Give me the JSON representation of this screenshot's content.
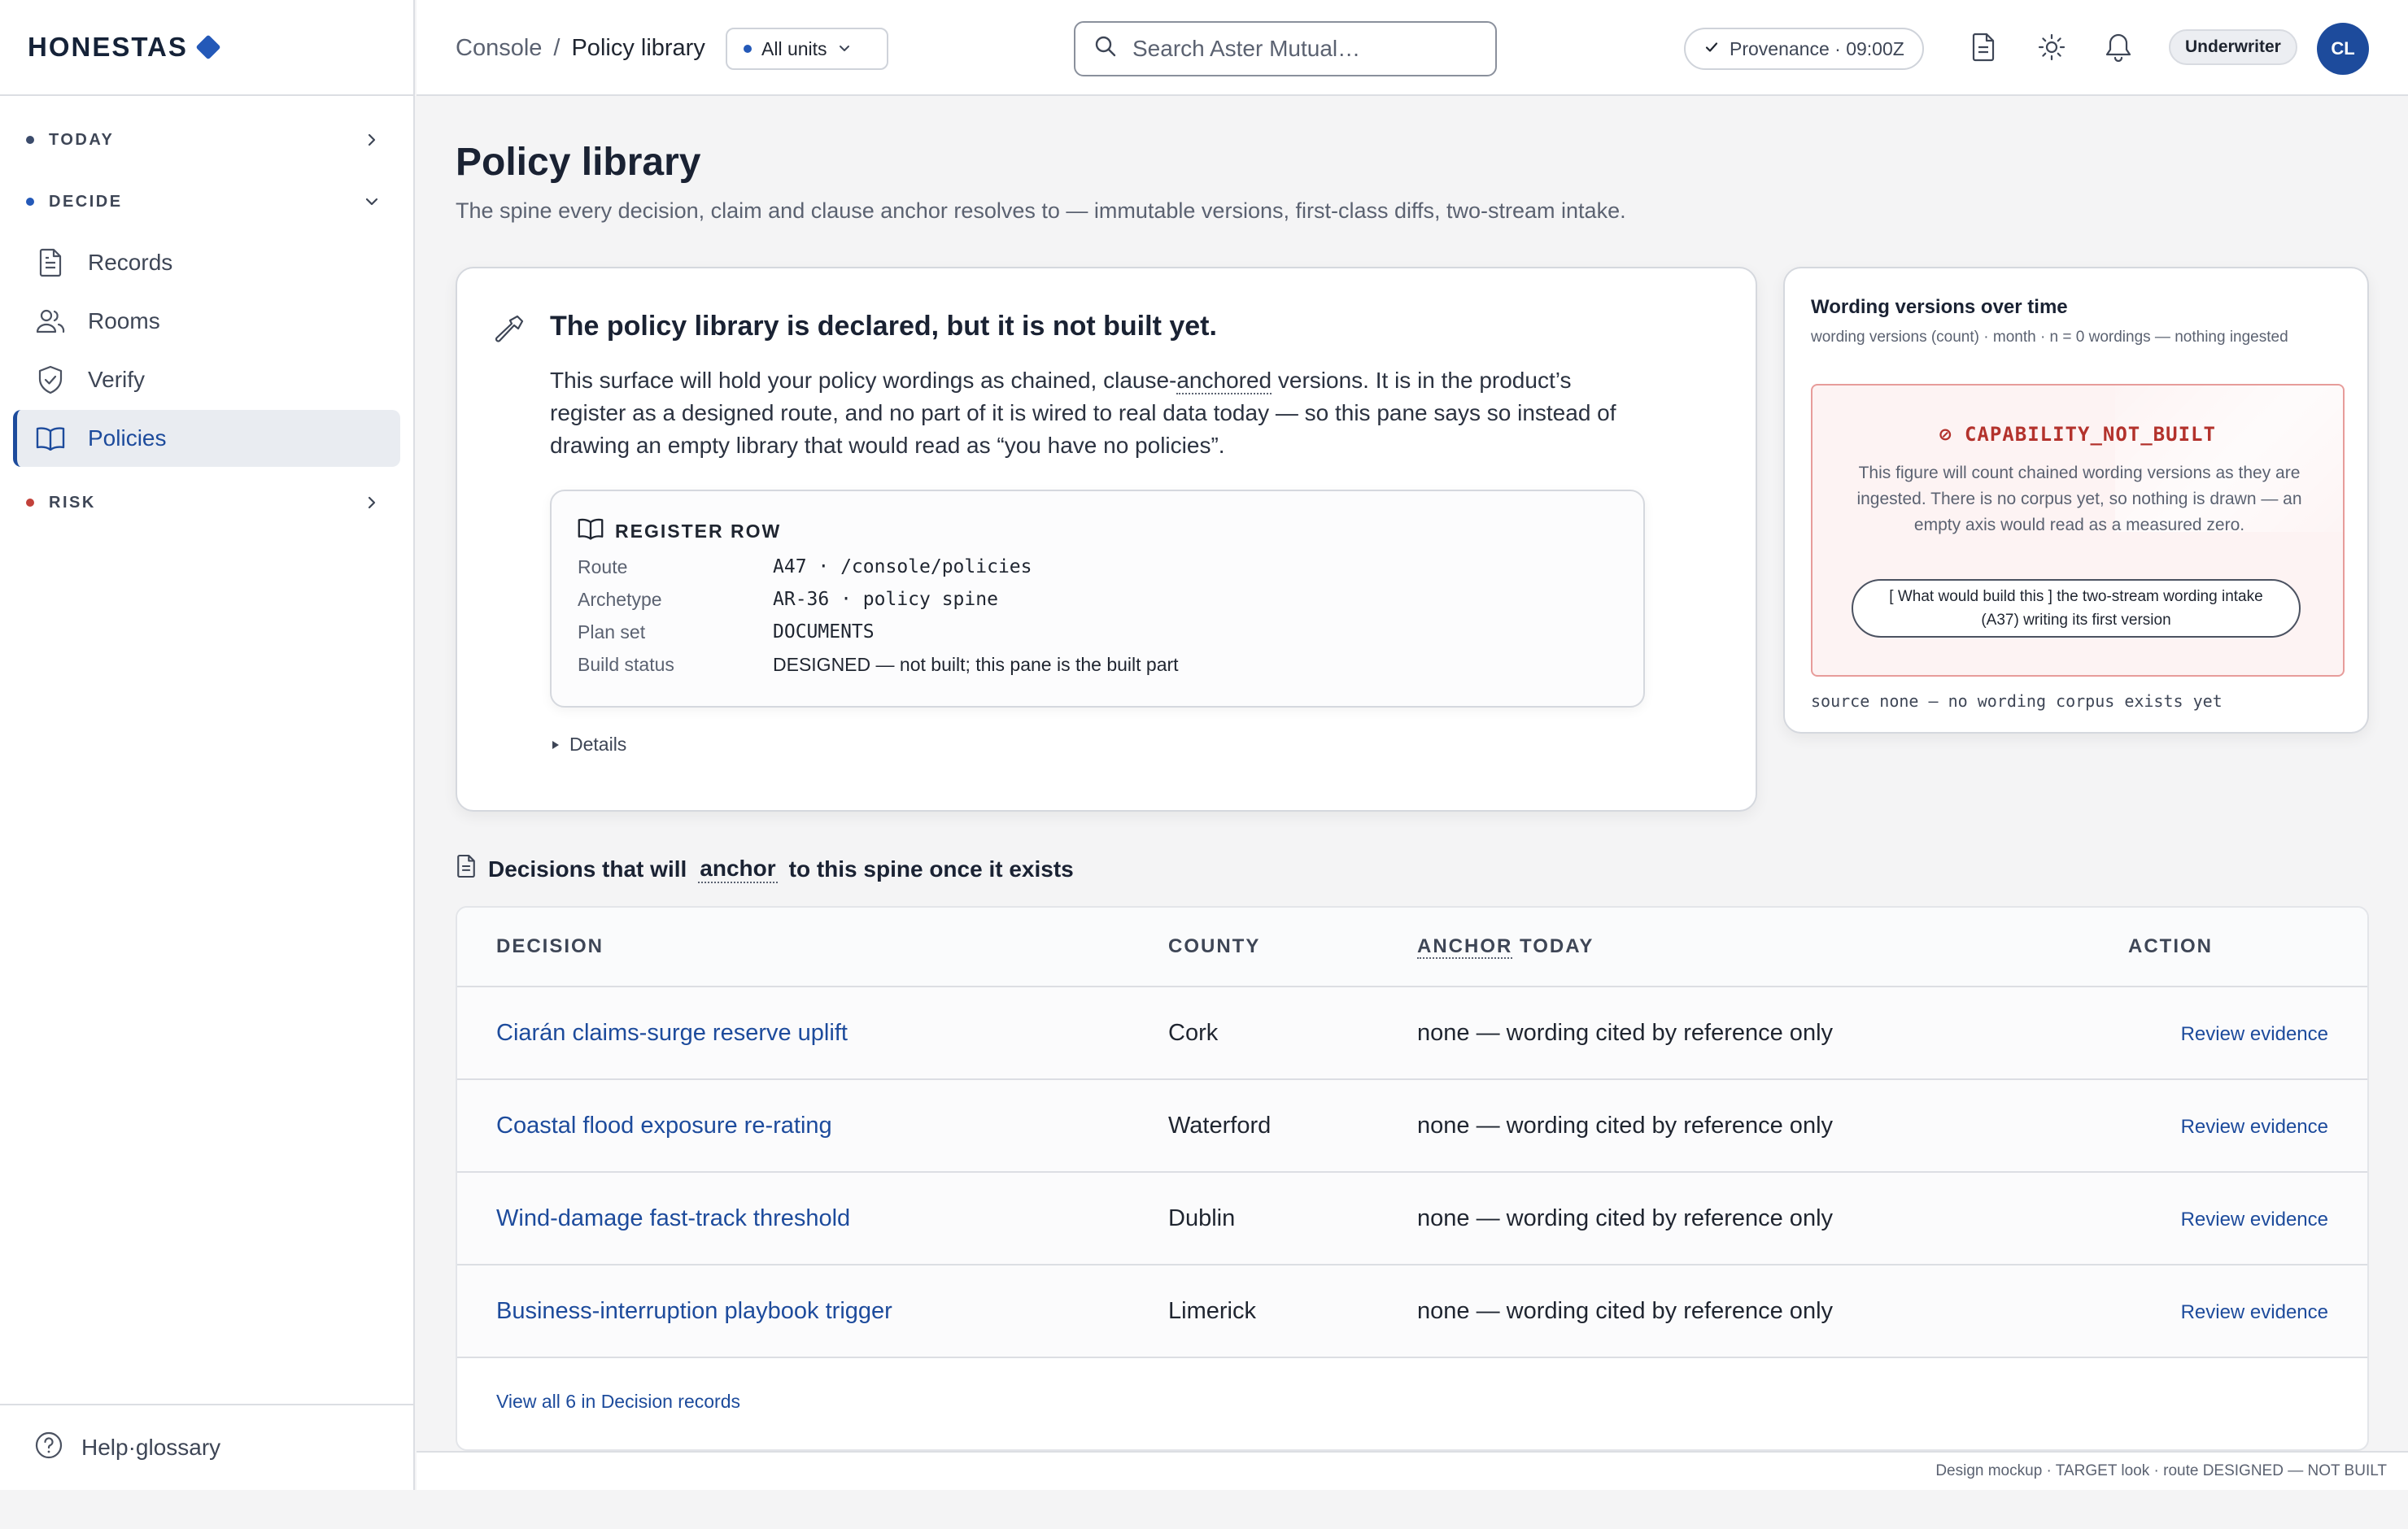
{
  "brand": {
    "name": "HONESTAS"
  },
  "sidebar": {
    "groups": [
      {
        "label": "TODAY"
      },
      {
        "label": "DECIDE"
      },
      {
        "label": "RISK"
      }
    ],
    "items": [
      {
        "label": "Records",
        "icon": "document-icon"
      },
      {
        "label": "Rooms",
        "icon": "users-icon"
      },
      {
        "label": "Verify",
        "icon": "shield-check-icon"
      },
      {
        "label": "Policies",
        "icon": "book-icon"
      }
    ],
    "help": "Help·glossary"
  },
  "topbar": {
    "breadcrumb_root": "Console",
    "breadcrumb_sep": "/",
    "breadcrumb_current": "Policy library",
    "units": "All units",
    "search_placeholder": "Search Aster Mutual…",
    "provenance": "Provenance · 09:00Z",
    "role": "Underwriter",
    "avatar": "CL"
  },
  "page": {
    "title": "Policy library",
    "subtitle": "The spine every decision, claim and clause anchor resolves to — immutable versions, first-class diffs, two-stream intake."
  },
  "notice": {
    "heading": "The policy library is declared, but it is not built yet.",
    "body_1": "This surface will hold your policy wordings as chained, clause-",
    "body_anchor": "anchored",
    "body_2": " versions. It is in the product’s register as a designed route, and no part of it is wired to real data today — so this pane says so instead of drawing an empty library that would read as “you have no policies”.",
    "register": {
      "heading": "REGISTER ROW",
      "rows": [
        {
          "k": "Route",
          "v": "A47 · /console/policies"
        },
        {
          "k": "Archetype",
          "v": "AR-36 · policy spine"
        },
        {
          "k": "Plan set",
          "v": "DOCUMENTS"
        },
        {
          "k": "Build status",
          "v": "DESIGNED — not built; this pane is the built part"
        }
      ]
    },
    "details": "Details"
  },
  "wording": {
    "title": "Wording versions over time",
    "subtitle": "wording versions (count) · month · n = 0 wordings — nothing ingested",
    "code": "⊘ CAPABILITY_NOT_BUILT",
    "desc": "This figure will count chained wording versions as they are ingested. There is no corpus yet, so nothing is drawn — an empty axis would read as a measured zero.",
    "pill": "[ What would build this ] the two-stream wording intake (A37) writing its first version",
    "source": "source none — no wording corpus exists yet"
  },
  "decisions": {
    "heading_1": "Decisions that will",
    "heading_anchor": "anchor",
    "heading_2": "to this spine once it exists",
    "columns": {
      "decision": "DECISION",
      "county": "COUNTY",
      "anchor_word": "ANCHOR",
      "anchor_rest": " TODAY",
      "action": "ACTION"
    },
    "rows": [
      {
        "decision": "Ciarán claims-surge reserve uplift",
        "county": "Cork",
        "anchor": "none — wording cited by reference only",
        "action": "Review evidence"
      },
      {
        "decision": "Coastal flood exposure re-rating",
        "county": "Waterford",
        "anchor": "none — wording cited by reference only",
        "action": "Review evidence"
      },
      {
        "decision": "Wind-damage fast-track threshold",
        "county": "Dublin",
        "anchor": "none — wording cited by reference only",
        "action": "Review evidence"
      },
      {
        "decision": "Business-interruption playbook trigger",
        "county": "Limerick",
        "anchor": "none — wording cited by reference only",
        "action": "Review evidence"
      }
    ],
    "view_all": "View all 6 in Decision records"
  },
  "footer": "Design mockup · TARGET look · route DESIGNED — NOT BUILT",
  "colors": {
    "accent": "#1d4b9c",
    "brand": "#2459b8",
    "danger": "#b3322c"
  }
}
